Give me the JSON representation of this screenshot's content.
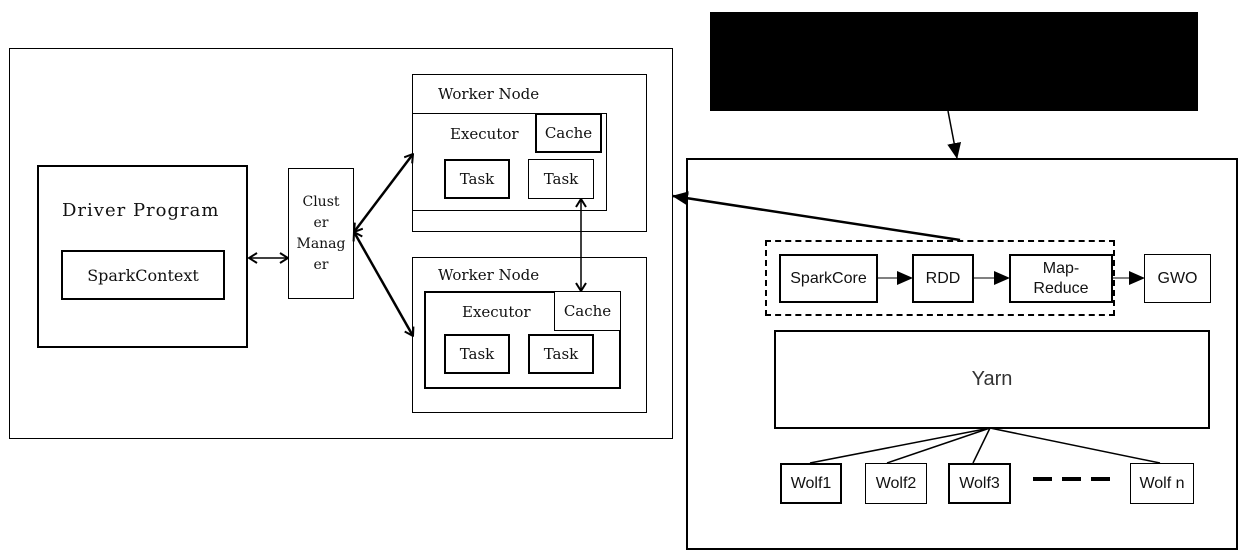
{
  "left_panel": {
    "driver": {
      "title": "Driver Program",
      "context": "SparkContext"
    },
    "cluster_manager": {
      "lines": [
        "Clust",
        "er",
        "Manag",
        "er"
      ]
    },
    "worker_nodes": [
      {
        "title": "Worker Node",
        "executor": "Executor",
        "cache": "Cache",
        "tasks": [
          "Task",
          "Task"
        ]
      },
      {
        "title": "Worker Node",
        "executor": "Executor",
        "cache": "Cache",
        "tasks": [
          "Task",
          "Task"
        ]
      }
    ]
  },
  "top_box": {
    "label": ""
  },
  "right_panel": {
    "pipeline": [
      "SparkCore",
      "RDD",
      "Map-\nReduce",
      "GWO"
    ],
    "pipeline_lines": {
      "map1": "Map-",
      "map2": "Reduce"
    },
    "yarn": "Yarn",
    "wolves": [
      "Wolf1",
      "Wolf2",
      "Wolf3",
      "Wolf n"
    ],
    "ellipsis": "dashed-ellipsis"
  }
}
